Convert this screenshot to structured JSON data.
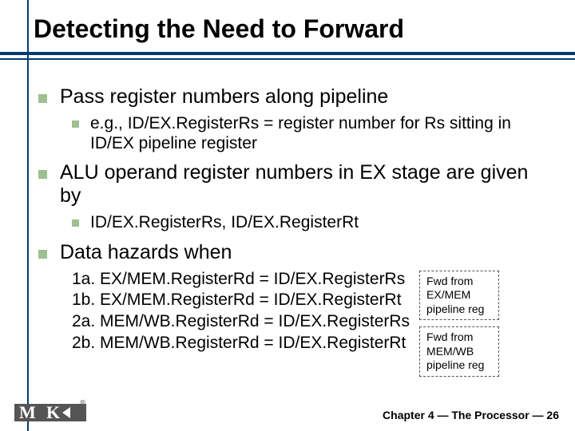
{
  "title": "Detecting the Need to Forward",
  "bullets": {
    "b1": "Pass register numbers along pipeline",
    "b1a": "e.g., ID/EX.RegisterRs = register number for Rs sitting in ID/EX pipeline register",
    "b2": "ALU operand register numbers in EX stage are given by",
    "b2a": "ID/EX.RegisterRs, ID/EX.RegisterRt",
    "b3": "Data hazards when"
  },
  "hazards": {
    "h1a": "1a. EX/MEM.RegisterRd = ID/EX.RegisterRs",
    "h1b": "1b. EX/MEM.RegisterRd = ID/EX.RegisterRt",
    "h2a": "2a. MEM/WB.RegisterRd = ID/EX.RegisterRs",
    "h2b": "2b. MEM/WB.RegisterRd = ID/EX.RegisterRt"
  },
  "fwd": {
    "box1": "Fwd from EX/MEM pipeline reg",
    "box2": "Fwd from MEM/WB pipeline reg"
  },
  "footer": "Chapter 4 — The Processor — 26"
}
